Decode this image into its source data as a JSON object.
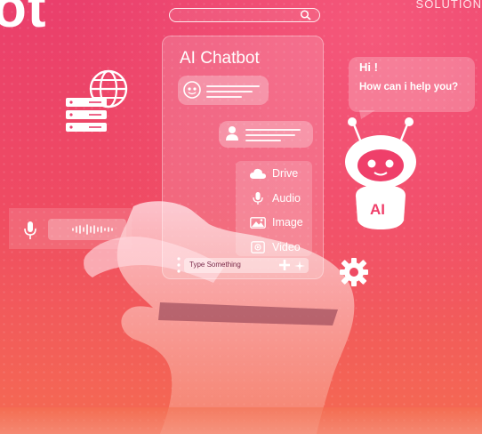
{
  "brand_text": "ot",
  "corner_text": "SOLUTION",
  "search_icon": "search-icon",
  "phone": {
    "title": "AI Chatbot",
    "menu": [
      {
        "label": "Drive",
        "icon": "cloud-icon"
      },
      {
        "label": "Audio",
        "icon": "microphone-icon"
      },
      {
        "label": "Image",
        "icon": "image-icon"
      },
      {
        "label": "Video",
        "icon": "video-icon"
      }
    ],
    "input_placeholder": "Type Something"
  },
  "speech_bubble": {
    "line1": "Hi !",
    "line2": "How can i help you?"
  },
  "robot": {
    "badge": "AI"
  },
  "colors": {
    "background_top": "#ea3f6c",
    "background_bottom": "#f56a52",
    "glass": "#ffffff"
  }
}
